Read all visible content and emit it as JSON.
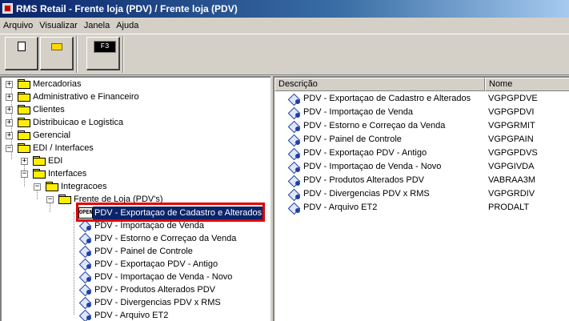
{
  "window": {
    "title": "RMS Retail - Frente loja (PDV) / Frente loja (PDV)"
  },
  "menu": [
    "Arquivo",
    "Visualizar",
    "Janela",
    "Ajuda"
  ],
  "toolbar": {
    "buttons": [
      {
        "name": "new-button",
        "icon": "new-document-icon"
      },
      {
        "name": "open-button",
        "icon": "open-folder-icon"
      },
      {
        "name": "f3-button",
        "icon": "f3-key-icon",
        "label": "F3"
      }
    ]
  },
  "tree": {
    "roots": [
      {
        "label": "Mercadorias",
        "expanded": false
      },
      {
        "label": "Administrativo e Financeiro",
        "expanded": false
      },
      {
        "label": "Clientes",
        "expanded": false
      },
      {
        "label": "Distribuicao e Logistica",
        "expanded": false
      },
      {
        "label": "Gerencial",
        "expanded": false
      },
      {
        "label": "EDI / Interfaces",
        "expanded": true
      }
    ],
    "edi_children": [
      {
        "label": "EDI",
        "expanded": false
      },
      {
        "label": "Interfaces",
        "expanded": true
      }
    ],
    "integracoes": "Integracoes",
    "frente_loja": "Frente de Loja (PDV's)",
    "selected_icon_text": "OPEN",
    "programs": [
      "PDV - Exportaçao de Cadastro e Alterados",
      "PDV - Importaçao de Venda",
      "PDV - Estorno e Correçao da Venda",
      "PDV - Painel de Controle",
      "PDV - Exportaçao PDV - Antigo",
      "PDV - Importaçao de Venda - Novo",
      "PDV - Produtos Alterados PDV",
      "PDV - Divergencias PDV x RMS",
      "PDV - Arquivo ET2"
    ]
  },
  "list": {
    "columns": [
      "Descrição",
      "Nome"
    ],
    "rows": [
      {
        "desc": "PDV - Exportaçao de Cadastro e Alterados",
        "name": "VGPGPDVE"
      },
      {
        "desc": "PDV - Importaçao de Venda",
        "name": "VGPGPDVI"
      },
      {
        "desc": "PDV - Estorno e Correçao da Venda",
        "name": "VGPGRMIT"
      },
      {
        "desc": "PDV - Painel de Controle",
        "name": "VGPGPAIN"
      },
      {
        "desc": "PDV - Exportaçao PDV - Antigo",
        "name": "VGPGPDVS"
      },
      {
        "desc": "PDV - Importaçao de Venda - Novo",
        "name": "VGPGIVDA"
      },
      {
        "desc": "PDV - Produtos Alterados PDV",
        "name": "VABRAA3M"
      },
      {
        "desc": "PDV - Divergencias PDV x RMS",
        "name": "VGPGRDIV"
      },
      {
        "desc": "PDV - Arquivo ET2",
        "name": "PRODALT"
      }
    ]
  },
  "colors": {
    "title_start": "#0a246a",
    "title_end": "#a6caf0",
    "selection": "#0a246a",
    "highlight_border": "#e00000",
    "folder": "#ffee00"
  }
}
